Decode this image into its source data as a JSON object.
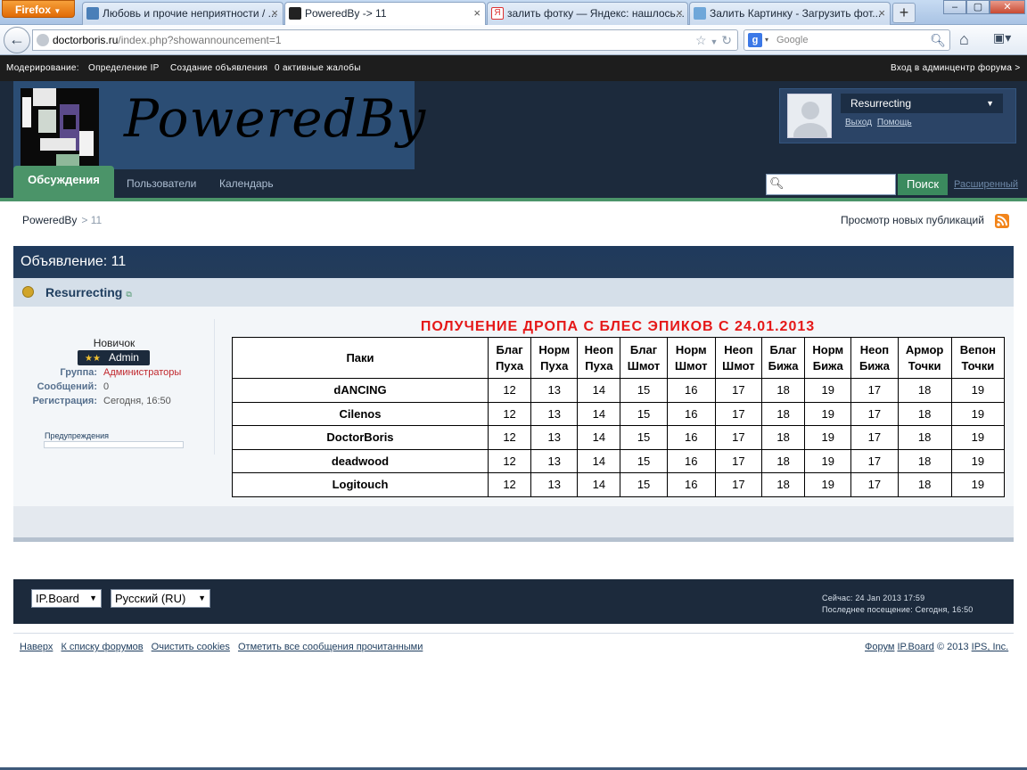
{
  "browser": {
    "menu_button": "Firefox",
    "tabs": [
      {
        "title": "Любовь и прочие неприятности / ...",
        "close": "×"
      },
      {
        "title": "PoweredBy -> 11",
        "close": "×"
      },
      {
        "title": "залить фотку — Яндекс: нашлось...",
        "close": "×"
      },
      {
        "title": "Залить Картинку - Загрузить фот...",
        "close": "×"
      }
    ],
    "new_tab": "+",
    "url_host": "doctorboris.ru",
    "url_path": "/index.php?showannouncement=1",
    "search_placeholder": "Google"
  },
  "modbar": {
    "label": "Модерирование:",
    "links": [
      "Определение IP",
      "Создание объявления",
      "0 активные жалобы"
    ],
    "admin_link": "Вход в админцентр форума >"
  },
  "header": {
    "logo_text": "PoweredBy",
    "user_menu": "Resurrecting",
    "logout": "Выход",
    "help": "Помощь"
  },
  "nav": {
    "active_tab": "Обсуждения",
    "links": [
      "Пользователи",
      "Календарь"
    ],
    "search_button": "Поиск",
    "advanced": "Расширенный"
  },
  "breadcrumb": {
    "root": "PoweredBy",
    "current": "> 11"
  },
  "new_posts_link": "Просмотр новых публикаций",
  "announcement": {
    "title": "Объявление: 11",
    "author": "Resurrecting",
    "rank": "Новичок",
    "badge": "Admin",
    "badge_stars": "★★",
    "fields": [
      {
        "label": "Группа:",
        "value": "Администраторы"
      },
      {
        "label": "Сообщений:",
        "value": "0"
      },
      {
        "label": "Регистрация:",
        "value": "Сегодня, 16:50"
      }
    ],
    "warnings_label": "Предупреждения",
    "heading": "ПОЛУЧЕНИЕ ДРОПА С БЛЕС ЭПИКОВ С 24.01.2013",
    "table": {
      "headers": [
        [
          "Паки",
          ""
        ],
        [
          "Благ",
          "Пуха"
        ],
        [
          "Норм",
          "Пуха"
        ],
        [
          "Неоп",
          "Пуха"
        ],
        [
          "Благ",
          "Шмот"
        ],
        [
          "Норм",
          "Шмот"
        ],
        [
          "Неоп",
          "Шмот"
        ],
        [
          "Благ",
          "Бижа"
        ],
        [
          "Норм",
          "Бижа"
        ],
        [
          "Неоп",
          "Бижа"
        ],
        [
          "Армор",
          "Точки"
        ],
        [
          "Вепон",
          "Точки"
        ]
      ],
      "rows": [
        [
          "dANCING",
          "12",
          "13",
          "14",
          "15",
          "16",
          "17",
          "18",
          "19",
          "17",
          "18",
          "19"
        ],
        [
          "Cilenos",
          "12",
          "13",
          "14",
          "15",
          "16",
          "17",
          "18",
          "19",
          "17",
          "18",
          "19"
        ],
        [
          "DoctorBoris",
          "12",
          "13",
          "14",
          "15",
          "16",
          "17",
          "18",
          "19",
          "17",
          "18",
          "19"
        ],
        [
          "deadwood",
          "12",
          "13",
          "14",
          "15",
          "16",
          "17",
          "18",
          "19",
          "17",
          "18",
          "19"
        ],
        [
          "Logitouch",
          "12",
          "13",
          "14",
          "15",
          "16",
          "17",
          "18",
          "19",
          "17",
          "18",
          "19"
        ]
      ]
    }
  },
  "footer": {
    "skin": "IP.Board",
    "language": "Русский (RU)",
    "now": "Сейчас: 24 Jan 2013 17:59",
    "last_visit": "Последнее посещение: Сегодня, 16:50",
    "links": [
      "Наверх",
      "К списку форумов",
      "Очистить cookies",
      "Отметить все сообщения прочитанными"
    ],
    "copy_forum": "Форум",
    "copy_board": "IP.Board",
    "copy_year": "© 2013",
    "copy_ips": "IPS, Inc."
  },
  "colors": {
    "accent_green": "#4b9469",
    "header_dark": "#1c2a3c",
    "heading_red": "#e51818"
  }
}
